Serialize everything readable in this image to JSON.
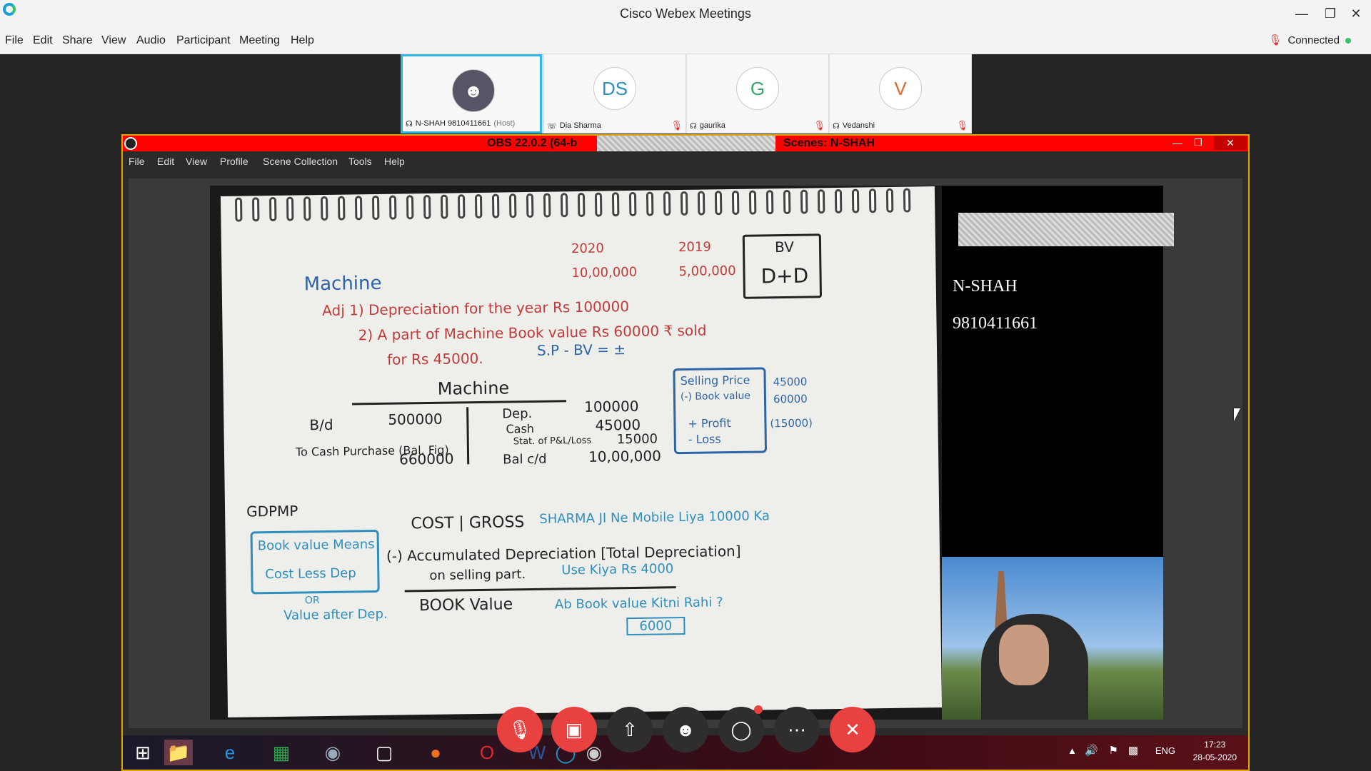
{
  "titlebar": {
    "title": "Cisco Webex Meetings"
  },
  "menu": [
    "File",
    "Edit",
    "Share",
    "View",
    "Audio",
    "Participant",
    "Meeting",
    "Help"
  ],
  "status": {
    "label": "Connected"
  },
  "participants": [
    {
      "name": "N-SHAH 9810411661",
      "role": "(Host)",
      "initials": "",
      "active": true
    },
    {
      "name": "Dia Sharma",
      "role": "",
      "initials": "DS",
      "active": false
    },
    {
      "name": "gaurika",
      "role": "",
      "initials": "G",
      "active": false
    },
    {
      "name": "Vedanshi",
      "role": "",
      "initials": "V",
      "active": false
    }
  ],
  "obs": {
    "title": "OBS 22.0.2 (64-b",
    "scene": "Scenes: N-SHAH",
    "menu": [
      "File",
      "Edit",
      "View",
      "Profile",
      "Scene Collection",
      "Tools",
      "Help"
    ]
  },
  "side_panel": {
    "name": "N-SHAH",
    "phone": "9810411661"
  },
  "whiteboard": {
    "year1": "2020",
    "year2": "2019",
    "val1": "10,00,000",
    "val2": "5,00,000",
    "bv": "BV",
    "dd": "D+D",
    "heading": "Machine",
    "adj1": "Adj 1) Depreciation for the year Rs 100000",
    "adj2": "2) A part of Machine Book value Rs 60000 ₹ sold",
    "adj3": "for Rs 45000.",
    "formula": "S.P - BV = ±",
    "acct_title": "Machine",
    "bd": "B/d",
    "bd_val": "500000",
    "purchase": "To Cash Purchase (Bal. Fig)",
    "purchase_val": "660000",
    "dep": "Dep.",
    "dep_val": "100000",
    "cash": "Cash",
    "cash_val": "45000",
    "loss": "Stat. of P&L/Loss",
    "loss_val": "15000",
    "bal": "Bal c/d",
    "bal_val": "10,00,000",
    "sp": "Selling Price",
    "sp_val": "45000",
    "bvl": "(-) Book value",
    "bvl_val": "60000",
    "profit": "+ Profit",
    "lossr": "- Loss",
    "diff": "(15000)",
    "gdpmp": "GDPMP",
    "box1": "Book value Means",
    "box2": "Cost Less Dep",
    "or": "OR",
    "after": "Value after Dep.",
    "cost": "COST | GROSS",
    "acc_dep": "(-) Accumulated Depreciation [Total Depreciation]",
    "on_sell": "on selling part.",
    "book": "BOOK Value",
    "sharma": "SHARMA JI Ne Mobile Liya 10000 Ka",
    "use": "Use Kiya Rs 4000",
    "ab": "Ab Book value Kitni Rahi ?",
    "ans": "6000"
  },
  "taskbar": {
    "lang": "ENG",
    "time": "17:23",
    "date": "28-05-2020"
  }
}
